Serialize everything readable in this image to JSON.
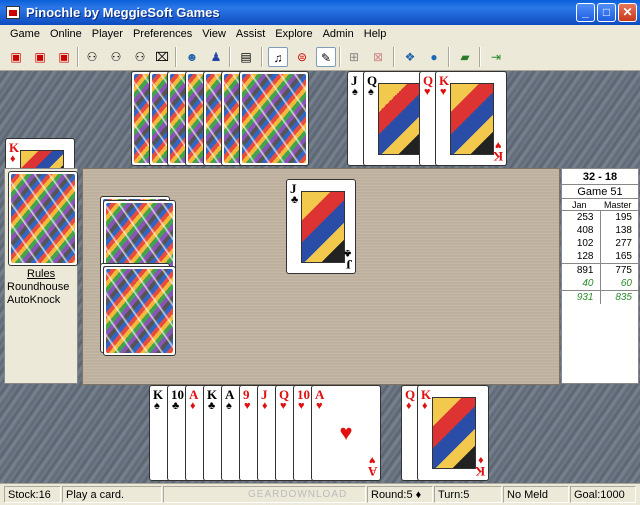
{
  "window": {
    "title": "Pinochle by MeggieSoft Games",
    "min": "_",
    "max": "□",
    "close": "✕"
  },
  "menu": [
    "Game",
    "Online",
    "Player",
    "Preferences",
    "View",
    "Assist",
    "Explore",
    "Admin",
    "Help"
  ],
  "toolbar_icons": [
    "new-game-icon",
    "open-icon",
    "save-icon",
    "players-icon",
    "hint-icon",
    "undo-icon",
    "wizard-icon",
    "assist-icon",
    "rules-icon",
    "sound-icon",
    "auto-icon",
    "options-icon",
    "network-icon",
    "chat-icon",
    "web-icon",
    "globe-icon",
    "book-icon",
    "exit-icon"
  ],
  "west_panel": {
    "rules_link": "Rules",
    "line1": "Roundhouse",
    "line2": "AutoKnock"
  },
  "north_meld": [
    {
      "rank": "J",
      "suit": "♠",
      "color": "black"
    },
    {
      "rank": "Q",
      "suit": "♠",
      "color": "black"
    },
    {
      "rank": "Q",
      "suit": "♥",
      "color": "red"
    },
    {
      "rank": "K",
      "suit": "♥",
      "color": "red"
    }
  ],
  "west_meld": {
    "rank": "K",
    "suit": "♦",
    "color": "red"
  },
  "trick_card": {
    "rank": "J",
    "suit": "♣",
    "color": "black"
  },
  "south_hand": [
    {
      "rank": "K",
      "suit": "♠",
      "color": "black"
    },
    {
      "rank": "10",
      "suit": "♣",
      "color": "black"
    },
    {
      "rank": "A",
      "suit": "♦",
      "color": "red"
    },
    {
      "rank": "K",
      "suit": "♣",
      "color": "black"
    },
    {
      "rank": "A",
      "suit": "♠",
      "color": "black"
    },
    {
      "rank": "9",
      "suit": "♥",
      "color": "red"
    },
    {
      "rank": "J",
      "suit": "♦",
      "color": "red"
    },
    {
      "rank": "Q",
      "suit": "♥",
      "color": "red"
    },
    {
      "rank": "10",
      "suit": "♥",
      "color": "red"
    },
    {
      "rank": "A",
      "suit": "♥",
      "color": "red"
    }
  ],
  "south_meld": [
    {
      "rank": "Q",
      "suit": "♦",
      "color": "red"
    },
    {
      "rank": "K",
      "suit": "♦",
      "color": "red"
    }
  ],
  "score": {
    "header": "32 - 18",
    "game": "Game  51",
    "col1": "Jan",
    "col2": "Master",
    "rows": [
      [
        "253",
        "195"
      ],
      [
        "408",
        "138"
      ],
      [
        "102",
        "277"
      ],
      [
        "128",
        "165"
      ]
    ],
    "total": [
      "891",
      "775"
    ],
    "need": [
      "40",
      "60"
    ],
    "projected": [
      "931",
      "835"
    ]
  },
  "status": {
    "stock": "Stock:16",
    "message": "Play a card.",
    "round": "Round:5 ♦",
    "turn": "Turn:5",
    "meld": "No Meld",
    "goal": "Goal:1000"
  },
  "watermark": "GEARDOWNLOAD"
}
